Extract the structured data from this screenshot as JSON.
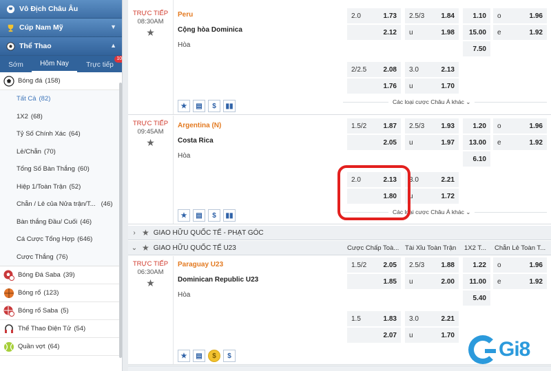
{
  "sidebar": {
    "sections": [
      {
        "label": "Vô Địch Châu Âu"
      },
      {
        "label": "Cúp Nam Mỹ"
      },
      {
        "label": "Thể Thao"
      }
    ],
    "tabs": [
      {
        "label": "Sớm"
      },
      {
        "label": "Hôm Nay"
      },
      {
        "label": "Trực tiếp",
        "badge": "107"
      }
    ],
    "football": {
      "label": "Bóng đá",
      "count": "(158)"
    },
    "subitems": [
      {
        "label": "Tất Cả",
        "count": "(82)"
      },
      {
        "label": "1X2",
        "count": "(68)"
      },
      {
        "label": "Tỷ Số Chính Xác",
        "count": "(64)"
      },
      {
        "label": "Lẻ/Chẵn",
        "count": "(70)"
      },
      {
        "label": "Tổng Số Bàn Thắng",
        "count": "(60)"
      },
      {
        "label": "Hiệp 1/Toàn Trận",
        "count": "(52)"
      },
      {
        "label": "Chẵn / Lẻ của Nửa trận/T...",
        "count": "(46)"
      },
      {
        "label": "Bàn thắng Đầu/ Cuối",
        "count": "(46)"
      },
      {
        "label": "Cá Cược Tổng Hợp",
        "count": "(646)"
      },
      {
        "label": "Cược Thắng",
        "count": "(76)"
      }
    ],
    "sports": [
      {
        "label": "Bóng Đá Saba",
        "count": "(39)"
      },
      {
        "label": "Bóng rổ",
        "count": "(123)"
      },
      {
        "label": "Bóng rổ Saba",
        "count": "(5)"
      },
      {
        "label": "Thể Thao Điện Tử",
        "count": "(54)"
      },
      {
        "label": "Quần vợt",
        "count": "(64)"
      }
    ]
  },
  "matches": [
    {
      "status": "TRỰC TIẾP",
      "time": "08:30AM",
      "home": "Peru",
      "away": "Cộng hòa Dominica",
      "draw": "Hòa",
      "odds": {
        "hdp1_line": "2.0",
        "hdp1_a": "1.73",
        "hdp1_b": "2.12",
        "ou1_line": "2.5/3",
        "ou1_a": "1.84",
        "ou1_u": "u",
        "ou1_b": "1.98",
        "x12_1": "1.10",
        "x12_2": "15.00",
        "x12_x": "7.50",
        "oe_o": "o",
        "oe_a": "1.96",
        "oe_e": "e",
        "oe_b": "1.92",
        "hdp2_line": "2/2.5",
        "hdp2_a": "2.08",
        "hdp2_b": "1.76",
        "ou2_line": "3.0",
        "ou2_a": "2.13",
        "ou2_u": "u",
        "ou2_b": "1.70"
      },
      "more": "Các loại cược Châu Á khác"
    },
    {
      "status": "TRỰC TIẾP",
      "time": "09:45AM",
      "home": "Argentina (N)",
      "away": "Costa Rica",
      "draw": "Hòa",
      "odds": {
        "hdp1_line": "1.5/2",
        "hdp1_a": "1.87",
        "hdp1_b": "2.05",
        "ou1_line": "2.5/3",
        "ou1_a": "1.93",
        "ou1_u": "u",
        "ou1_b": "1.97",
        "x12_1": "1.20",
        "x12_2": "13.00",
        "x12_x": "6.10",
        "oe_o": "o",
        "oe_a": "1.96",
        "oe_e": "e",
        "oe_b": "1.92",
        "hdp2_line": "2.0",
        "hdp2_a": "2.13",
        "hdp2_b": "1.80",
        "ou2_line": "3.0",
        "ou2_a": "2.21",
        "ou2_u": "u",
        "ou2_b": "1.72"
      },
      "more": "Các loại cược Châu Á khác"
    },
    {
      "status": "TRỰC TIẾP",
      "time": "06:30AM",
      "home": "Paraguay U23",
      "away": "Dominican Republic U23",
      "draw": "Hòa",
      "odds": {
        "hdp1_line": "1.5/2",
        "hdp1_a": "2.05",
        "hdp1_b": "1.85",
        "ou1_line": "2.5/3",
        "ou1_a": "1.88",
        "ou1_u": "u",
        "ou1_b": "2.00",
        "x12_1": "1.22",
        "x12_2": "11.00",
        "x12_x": "5.40",
        "oe_o": "o",
        "oe_a": "1.96",
        "oe_e": "e",
        "oe_b": "1.92",
        "hdp2_line": "1.5",
        "hdp2_a": "1.83",
        "hdp2_b": "2.07",
        "ou2_line": "3.0",
        "ou2_a": "2.21",
        "ou2_u": "u",
        "ou2_b": "1.70"
      }
    }
  ],
  "leagues": [
    {
      "name": "GIAO HỮU QUỐC TẾ - PHẠT GÓC"
    },
    {
      "name": "GIAO HỮU QUỐC TẾ U23"
    }
  ],
  "columns": {
    "hdp": "Cược Chấp Toà...",
    "ou": "Tài Xỉu Toàn Trận",
    "x12": "1X2 T...",
    "oe": "Chẵn Lẻ Toàn T..."
  },
  "logo_text": "Gi8",
  "colors": {
    "accent": "#3e6fa6",
    "live": "#d13b2d",
    "home_team": "#e37a21",
    "highlight": "#e3201e",
    "logo": "#2b9adc"
  }
}
